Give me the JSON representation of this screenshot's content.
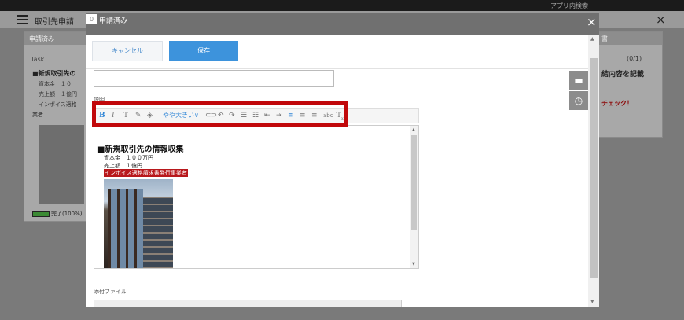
{
  "app": {
    "page_title": "取引先申請",
    "search_placeholder": "アプリ内検索"
  },
  "background": {
    "left_panel_title": "申請済み",
    "task_label": "Task",
    "heading": "■新規取引先の",
    "lines": [
      "資本金　１０",
      "売上額　１億円",
      "インボイス適格"
    ],
    "person_label": "業者",
    "done_label": "完了(100%)",
    "right_count": "(0/1)",
    "right_text1": "結内容を記載",
    "right_text2": "チェック！"
  },
  "modal": {
    "title": "申請済み",
    "title_icon": "0",
    "close_icon": "×",
    "cancel_label": "キャンセル",
    "save_label": "保存",
    "description_label": "説明",
    "attachment_label": "添付ファイル",
    "side_icons": [
      "comment-icon",
      "clock-icon"
    ]
  },
  "toolbar": {
    "bold": "B",
    "italic": "I",
    "text": "T",
    "font_size": "やや大きい",
    "items": [
      "bold-icon",
      "italic-icon",
      "text-icon",
      "pen-icon",
      "highlighter-icon",
      "font-size-select",
      "link-icon",
      "undo-icon",
      "redo-icon",
      "bullet-list-icon",
      "numbered-list-icon",
      "outdent-icon",
      "indent-icon",
      "align-left-icon",
      "align-center-icon",
      "align-right-icon",
      "strikethrough-icon",
      "clear-format-icon"
    ]
  },
  "editor": {
    "heading": "■新規取引先の情報収集",
    "line1": "資本金　１００万円",
    "line2": "売上額　１億円",
    "highlighted": "インボイス適格請求書発行事業者",
    "highlight_color": "#b8181c"
  },
  "colors": {
    "accent": "#3d93dc",
    "annotation": "#c1080b"
  }
}
